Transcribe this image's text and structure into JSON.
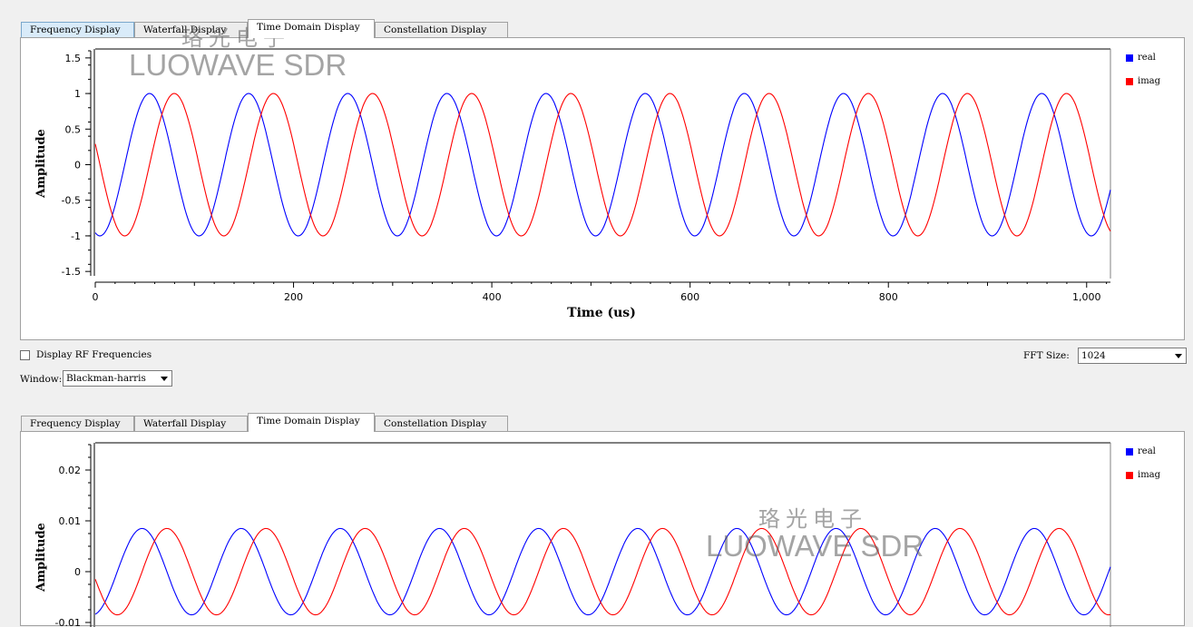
{
  "tabs": [
    "Frequency Display",
    "Waterfall Display",
    "Time Domain Display",
    "Constellation Display"
  ],
  "top_panel": {
    "active_tab": 2,
    "ylabel": "Amplitude",
    "xlabel": "Time (us)",
    "y_ticks": [
      "1.5",
      "1",
      "0.5",
      "0",
      "-0.5",
      "-1",
      "-1.5"
    ],
    "x_ticks": [
      "0",
      "200",
      "400",
      "600",
      "800",
      "1,000"
    ],
    "legend": [
      {
        "name": "real",
        "color": "#0000ff"
      },
      {
        "name": "imag",
        "color": "#ff0000"
      }
    ]
  },
  "controls": {
    "display_rf_label": "Display RF Frequencies",
    "display_rf_checked": false,
    "fft_size_label": "FFT Size:",
    "fft_size_value": "1024",
    "window_label": "Window:",
    "window_value": "Blackman-harris"
  },
  "bottom_panel": {
    "active_tab": 2,
    "ylabel": "Amplitude",
    "y_ticks": [
      "0.02",
      "0.01",
      "0",
      "-0.01"
    ],
    "legend": [
      {
        "name": "real",
        "color": "#0000ff"
      },
      {
        "name": "imag",
        "color": "#ff0000"
      }
    ]
  },
  "watermark": {
    "cn": "珞光电子",
    "en": "LUOWAVE SDR"
  },
  "chart_data": [
    {
      "type": "line",
      "title": "",
      "xlabel": "Time (us)",
      "ylabel": "Amplitude",
      "xlim": [
        0,
        1024
      ],
      "ylim": [
        -1.6,
        1.6
      ],
      "series": [
        {
          "name": "real",
          "color": "#0000ff",
          "amplitude": 1.0,
          "period_us": 100,
          "phase_deg": -107,
          "x": [
            0,
            1024
          ]
        },
        {
          "name": "imag",
          "color": "#ff0000",
          "amplitude": 1.0,
          "period_us": 100,
          "phase_deg": 163,
          "x": [
            0,
            1024
          ]
        }
      ],
      "legend": "top-right",
      "grid": false
    },
    {
      "type": "line",
      "title": "",
      "xlabel": "",
      "ylabel": "Amplitude",
      "xlim": [
        0,
        1024
      ],
      "ylim": [
        -0.015,
        0.025
      ],
      "series": [
        {
          "name": "real",
          "color": "#0000ff",
          "amplitude": 0.0085,
          "period_us": 100,
          "phase_deg": -80,
          "x": [
            0,
            1024
          ]
        },
        {
          "name": "imag",
          "color": "#ff0000",
          "amplitude": 0.0085,
          "period_us": 100,
          "phase_deg": -170,
          "x": [
            0,
            1024
          ]
        }
      ],
      "legend": "top-right",
      "grid": false
    }
  ]
}
